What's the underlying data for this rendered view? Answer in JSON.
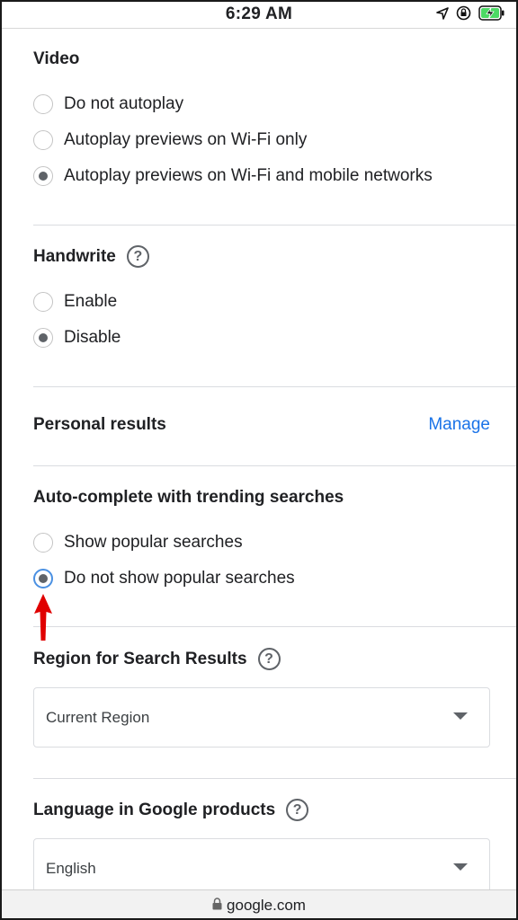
{
  "status": {
    "time": "6:29 AM"
  },
  "video": {
    "title": "Video",
    "options": [
      "Do not autoplay",
      "Autoplay previews on Wi-Fi only",
      "Autoplay previews on Wi-Fi and mobile networks"
    ],
    "selected": 2
  },
  "handwrite": {
    "title": "Handwrite",
    "help": "?",
    "options": [
      "Enable",
      "Disable"
    ],
    "selected": 1
  },
  "personal": {
    "title": "Personal results",
    "manage": "Manage"
  },
  "autocomplete": {
    "title": "Auto-complete with trending searches",
    "options": [
      "Show popular searches",
      "Do not show popular searches"
    ],
    "selected": 1
  },
  "region": {
    "title": "Region for Search Results",
    "help": "?",
    "value": "Current Region"
  },
  "language": {
    "title": "Language in Google products",
    "help": "?",
    "value": "English"
  },
  "urlbar": {
    "domain": "google.com"
  },
  "colors": {
    "link": "#1a73e8",
    "annotation_arrow": "#e00000",
    "radio_focus": "#4a90e2"
  }
}
